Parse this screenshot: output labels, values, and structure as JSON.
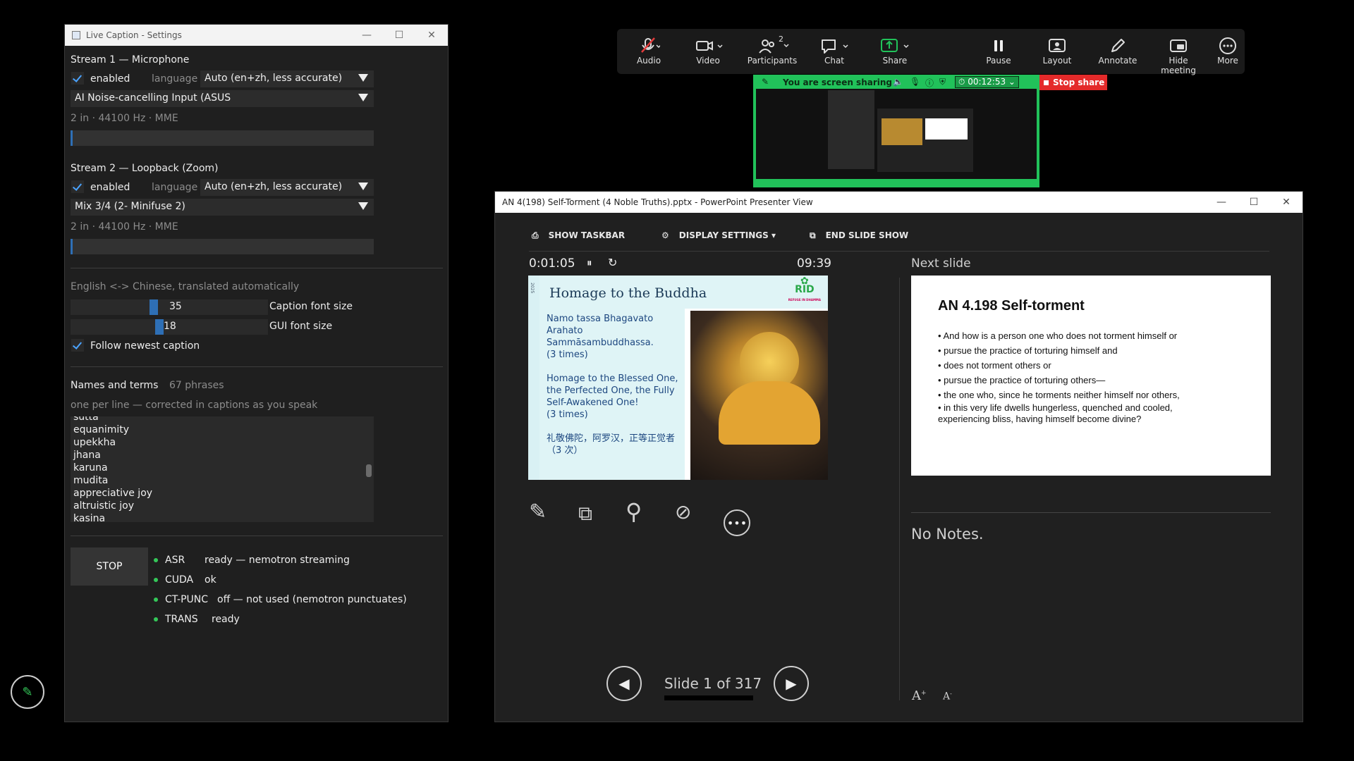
{
  "live_caption": {
    "title": "Live Caption - Settings",
    "stream1": {
      "heading": "Stream 1 — Microphone",
      "enabled_label": "enabled",
      "language_label": "language",
      "language_value": "Auto (en+zh, less accurate)",
      "device": "AI Noise-cancelling Input (ASUS",
      "info": "2 in · 44100 Hz · MME"
    },
    "stream2": {
      "heading": "Stream 2 — Loopback (Zoom)",
      "enabled_label": "enabled",
      "language_label": "language",
      "language_value": "Auto (en+zh, less accurate)",
      "device": "Mix 3/4 (2- Minifuse 2)",
      "info": "2 in · 44100 Hz · MME"
    },
    "translate_note": "English <-> Chinese, translated automatically",
    "caption_font_value": "35",
    "caption_font_label": "Caption font size",
    "gui_font_value": "18",
    "gui_font_label": "GUI font size",
    "follow_label": "Follow newest caption",
    "terms_heading": "Names and terms",
    "terms_count": "67 phrases",
    "terms_hint": "one per line — corrected in captions as you speak",
    "terms": [
      "sutta",
      "equanimity",
      "upekkha",
      "jhana",
      "karuna",
      "mudita",
      "appreciative joy",
      "altruistic joy",
      "kasina"
    ],
    "stop_label": "STOP",
    "status": [
      {
        "key": "ASR",
        "value": "ready — nemotron streaming"
      },
      {
        "key": "CUDA",
        "value": "ok"
      },
      {
        "key": "CT-PUNC",
        "value": "off — not used (nemotron punctuates)"
      },
      {
        "key": "TRANS",
        "value": "ready"
      }
    ]
  },
  "zoom": {
    "buttons": [
      "Audio",
      "Video",
      "Participants",
      "Chat",
      "Share",
      "Pause",
      "Layout",
      "Annotate",
      "Hide meeting",
      "More"
    ],
    "participants_count": "2",
    "sharing_text": "You are screen sharing",
    "timer": "00:12:53",
    "stop_share": "Stop share"
  },
  "presenter": {
    "title": "AN 4(198) Self-Torment   (4 Noble Truths).pptx - PowerPoint Presenter View",
    "show_taskbar": "SHOW TASKBAR",
    "display_settings": "DISPLAY SETTINGS ▾",
    "end_show": "END SLIDE SHOW",
    "elapsed": "0:01:05",
    "clock": "09:39",
    "next_label": "Next slide",
    "slide_counter": "Slide 1 of 317",
    "notes": "No Notes.",
    "current_slide": {
      "year": "2025",
      "title": "Homage to the Buddha",
      "logo": "RID",
      "logo_sub": "REFUGE IN DHAMMA",
      "pali": [
        "Namo tassa Bhagavato",
        "Arahato",
        "Sammāsambuddhassa.",
        "(3 times)"
      ],
      "english": [
        "Homage to the Blessed One,",
        "the Perfected One, the Fully",
        "Self-Awakened One!",
        "(3 times)"
      ],
      "chinese": [
        "礼敬佛陀，阿罗汉，正等正觉者",
        "（3 次）"
      ]
    },
    "next_slide": {
      "title": "AN 4.198 Self-torment",
      "bullets": [
        "And how is a person one who does not torment himself or",
        "pursue the practice of torturing himself and",
        "does not torment others or",
        "pursue the practice of torturing others—",
        "the one who, since he torments neither himself nor others,",
        "in this very life dwells hungerless, quenched and cooled, experiencing bliss, having himself become divine?"
      ]
    }
  },
  "colors": {
    "accent": "#2e6fb5",
    "share_green": "#21c25a",
    "stop_red": "#e42a2a",
    "status_ok": "#34c759"
  }
}
